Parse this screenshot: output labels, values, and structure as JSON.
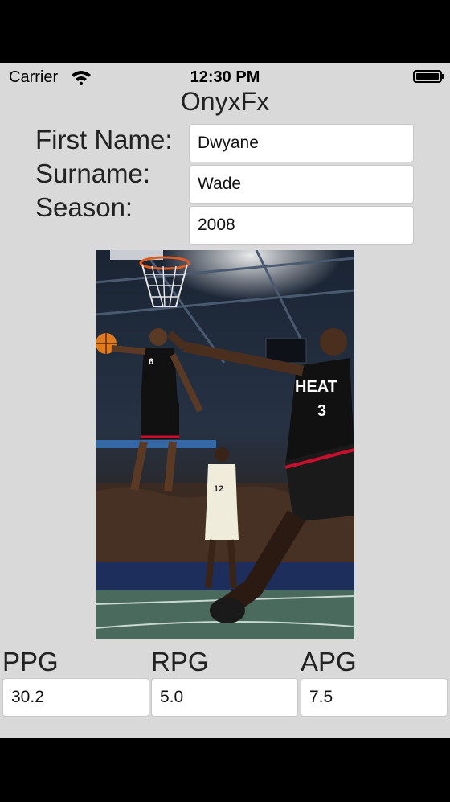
{
  "status_bar": {
    "carrier": "Carrier",
    "time": "12:30 PM"
  },
  "app": {
    "title": "OnyxFx"
  },
  "form": {
    "first_name_label": "First Name:",
    "first_name_value": "Dwyane",
    "surname_label": "Surname:",
    "surname_value": "Wade",
    "season_label": "Season:",
    "season_value": "2008"
  },
  "photo": {
    "jersey_front": "HEAT",
    "number_front": "3",
    "number_back": "6",
    "opponent_number": "12"
  },
  "stats": {
    "ppg_label": "PPG",
    "ppg_value": "30.2",
    "rpg_label": "RPG",
    "rpg_value": "5.0",
    "apg_label": "APG",
    "apg_value": "7.5"
  },
  "colors": {
    "screen_bg": "#d9d9d9",
    "jersey": "#111111",
    "accent": "#c8102e"
  }
}
